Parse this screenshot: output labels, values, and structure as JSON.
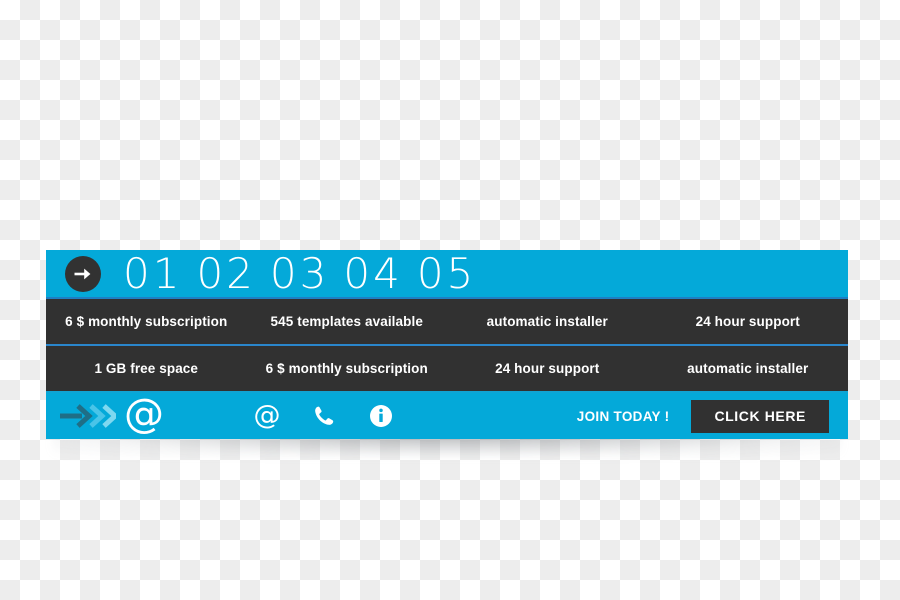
{
  "banner": {
    "header": {
      "arrow_badge_icon": "arrow-right-circle-icon",
      "steps": [
        "01",
        "02",
        "03",
        "04",
        "05"
      ]
    },
    "feature_rows": [
      {
        "cells": [
          "6 $ monthly subscription",
          "545 templates available",
          "automatic installer",
          "24 hour support"
        ]
      },
      {
        "cells": [
          "1 GB free space",
          "6 $ monthly subscription",
          "24 hour support",
          "automatic installer"
        ]
      }
    ],
    "footer": {
      "lead_arrow_icon": "double-chevron-right-icon",
      "email_symbol": "@",
      "contact_icons": [
        {
          "name": "at-icon",
          "glyph": "@"
        },
        {
          "name": "phone-icon",
          "glyph": ""
        },
        {
          "name": "info-icon",
          "glyph": ""
        }
      ],
      "join_label": "JOIN TODAY !",
      "cta_label": "CLICK HERE"
    },
    "colors": {
      "accent_blue": "#04a9d9",
      "dark_row": "#313131",
      "divider_blue": "#2a86cc",
      "text_white": "#ffffff"
    }
  }
}
